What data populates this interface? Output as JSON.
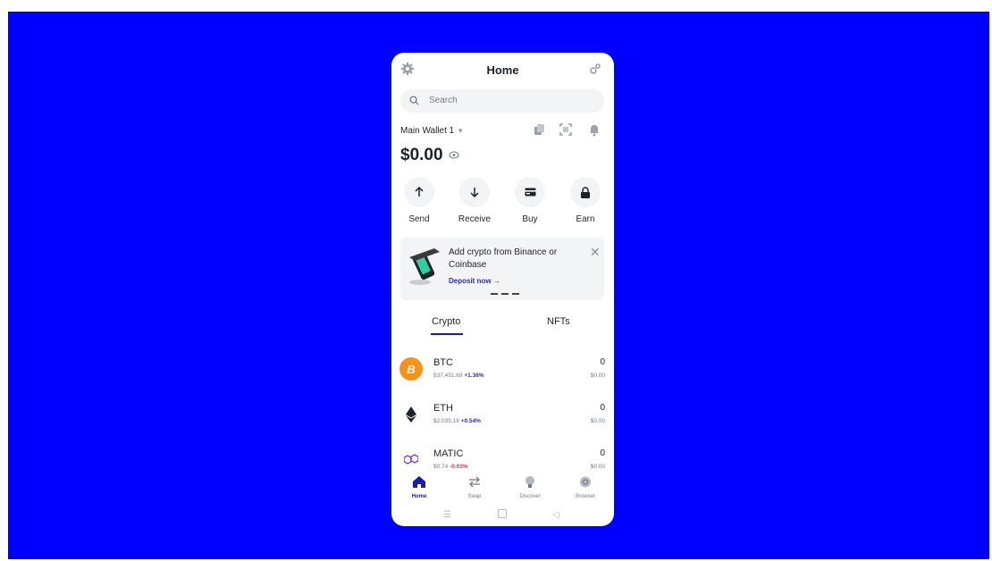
{
  "header": {
    "title": "Home",
    "settings_icon": "gear-icon",
    "connect_icon": "link-icon"
  },
  "search": {
    "placeholder": "Search"
  },
  "wallet": {
    "name": "Main Wallet 1",
    "balance": "$0.00"
  },
  "actions": [
    {
      "label": "Send",
      "icon": "arrow-up-icon"
    },
    {
      "label": "Receive",
      "icon": "arrow-down-icon"
    },
    {
      "label": "Buy",
      "icon": "card-icon"
    },
    {
      "label": "Earn",
      "icon": "lock-icon"
    }
  ],
  "banner": {
    "message": "Add crypto from Binance or Coinbase",
    "link": "Deposit now →"
  },
  "tabs": [
    {
      "label": "Crypto",
      "active": true
    },
    {
      "label": "NFTs",
      "active": false
    }
  ],
  "assets": [
    {
      "symbol": "BTC",
      "price": "$37,451.69",
      "change": "+1.36%",
      "amount": "0",
      "value": "$0.00",
      "color": "#f7931a"
    },
    {
      "symbol": "ETH",
      "price": "$2,035.18",
      "change": "+0.54%",
      "amount": "0",
      "value": "$0.00",
      "color": "#1e2329"
    },
    {
      "symbol": "MATIC",
      "price": "$0.74",
      "change": "-0.03%",
      "amount": "0",
      "value": "$0.00",
      "color": "#7b3fe4"
    }
  ],
  "nav": [
    {
      "label": "Home",
      "active": true
    },
    {
      "label": "Swap",
      "active": false
    },
    {
      "label": "Discover",
      "active": false
    },
    {
      "label": "Browser",
      "active": false
    }
  ],
  "colors": {
    "background": "#0000ff",
    "accent": "#1a1ab0",
    "positive": "#2e2ea6",
    "negative": "#cf304a"
  }
}
